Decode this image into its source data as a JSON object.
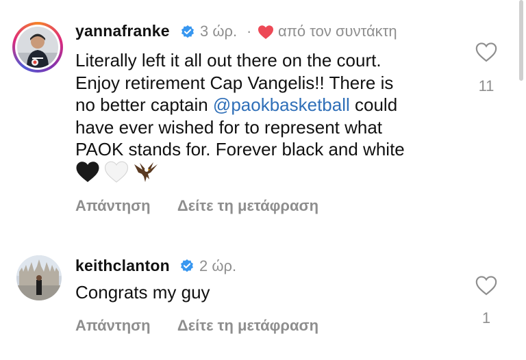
{
  "comments": [
    {
      "username": "yannafranke",
      "time": "3 ώρ.",
      "separator": "·",
      "liked_by_author": "από τον συντάκτη",
      "text_lines": [
        "Literally left it all out there on the court.",
        "Enjoy retirement Cap Vangelis!! There is",
        "no better captain ",
        "@paokbasketball",
        " could",
        "have ever wished for to represent what",
        "PAOK stands for. Forever black and white"
      ],
      "emojis": [
        "black-heart",
        "white-heart",
        "eagle"
      ],
      "reply_label": "Απάντηση",
      "translate_label": "Δείτε τη μετάφραση",
      "likes": "11"
    },
    {
      "username": "keithclanton",
      "time": "2 ώρ.",
      "text": "Congrats my guy",
      "reply_label": "Απάντηση",
      "translate_label": "Δείτε τη μετάφραση",
      "likes": "1"
    }
  ],
  "colors": {
    "verified_blue": "#3897f0",
    "author_heart": "#ed4956",
    "mention": "#2f6fb8",
    "secondary_text": "#8e8e8e"
  }
}
